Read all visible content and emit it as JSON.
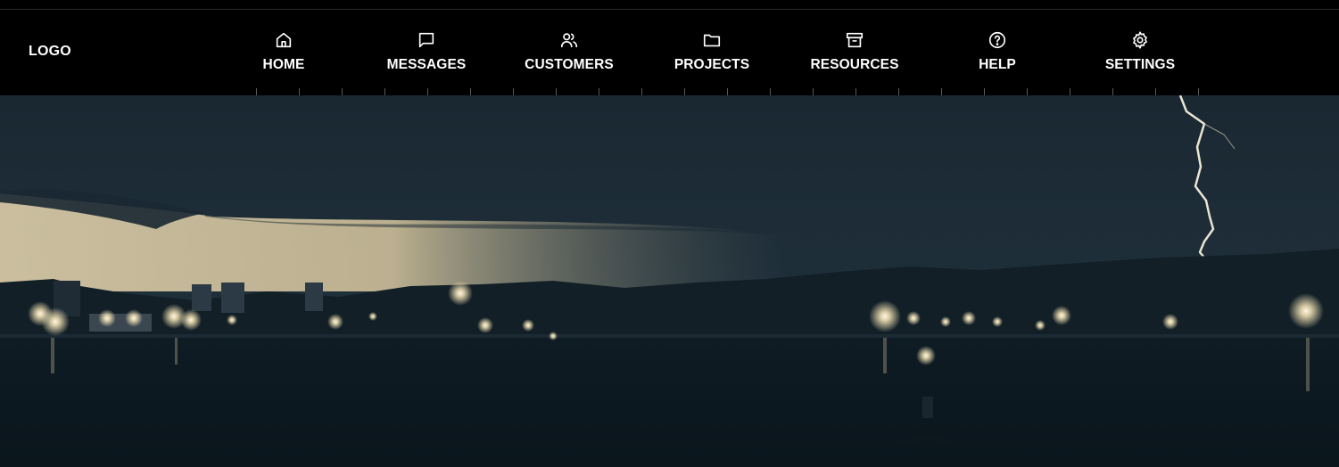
{
  "header": {
    "logo": "LOGO"
  },
  "nav": {
    "items": [
      {
        "label": "HOME",
        "icon": "home-icon"
      },
      {
        "label": "MESSAGES",
        "icon": "message-icon"
      },
      {
        "label": "CUSTOMERS",
        "icon": "users-icon"
      },
      {
        "label": "PROJECTS",
        "icon": "folder-icon"
      },
      {
        "label": "RESOURCES",
        "icon": "archive-icon"
      },
      {
        "label": "HELP",
        "icon": "help-icon"
      },
      {
        "label": "SETTINGS",
        "icon": "gear-icon"
      }
    ]
  },
  "hero": {
    "image": "night-harbor-lightning-photo"
  },
  "colors": {
    "navbar_bg": "#000000",
    "nav_text": "#ffffff",
    "sky_dark": "#1c2b35",
    "city_glow": "#d8c9a4",
    "water": "#0d1a22"
  }
}
